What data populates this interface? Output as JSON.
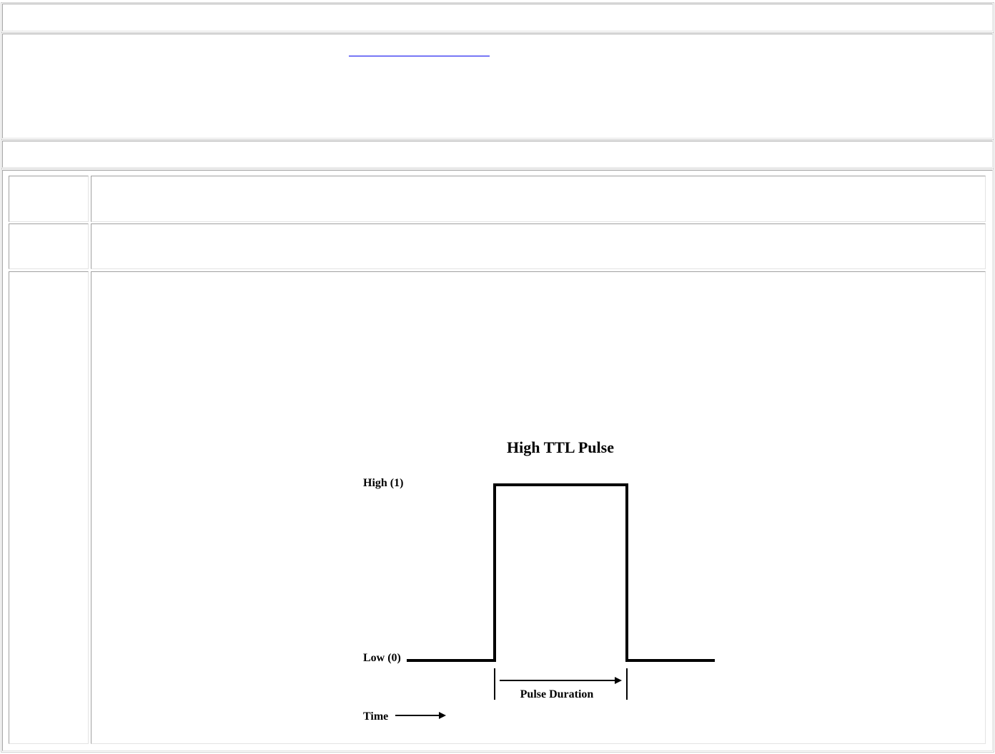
{
  "doc": {
    "link_text": ""
  },
  "figure": {
    "title": "High TTL Pulse",
    "high_label": "High (1)",
    "low_label": "Low (0)",
    "duration_label": "Pulse Duration",
    "time_label": "Time"
  }
}
